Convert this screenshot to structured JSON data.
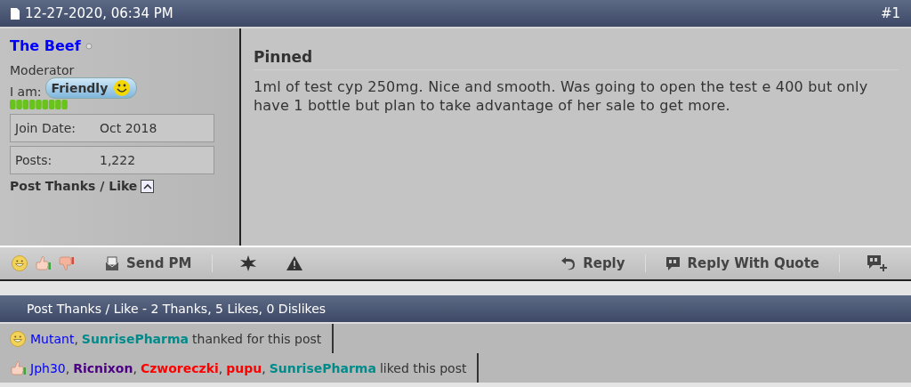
{
  "post_header": {
    "date": "12-27-2020, 06:34 PM",
    "number": "#1"
  },
  "user": {
    "name": "The Beef",
    "title": "Moderator",
    "mood_label": "I am:",
    "mood": "Friendly",
    "stats": [
      {
        "label": "Join Date:",
        "value": "Oct 2018"
      },
      {
        "label": "Posts:",
        "value": "1,222"
      }
    ],
    "thanks_toggle": "Post Thanks / Like"
  },
  "post": {
    "title": "Pinned",
    "body": "1ml of test cyp 250mg. Nice and smooth. Was going to open the test e 400 but only have 1 bottle but plan to take advantage of her sale to get more."
  },
  "toolbar": {
    "send_pm": "Send PM",
    "reply": "Reply",
    "reply_with_quote": "Reply With Quote"
  },
  "thanks": {
    "title": "Post Thanks / Like - 2 Thanks, 5 Likes, 0 Dislikes",
    "rows": [
      {
        "kind": "thanks",
        "separator": ",",
        "users": [
          {
            "name": "Mutant",
            "color": "#0000ff",
            "kind": "plain"
          },
          {
            "name": "SunrisePharma",
            "color": "#008b8b",
            "kind": "bold"
          }
        ],
        "text": "thanked for this post"
      },
      {
        "kind": "like",
        "separator": ",",
        "users": [
          {
            "name": "Jph30",
            "color": "#0000ff",
            "kind": "plain"
          },
          {
            "name": "Ricnixon",
            "color": "#4b0082",
            "kind": "bold"
          },
          {
            "name": "Czworeczki",
            "color": "#ff0000",
            "kind": "bold"
          },
          {
            "name": "pupu",
            "color": "#ff0000",
            "kind": "bold"
          },
          {
            "name": "SunrisePharma",
            "color": "#008b8b",
            "kind": "bold"
          }
        ],
        "text": "liked this post"
      }
    ]
  }
}
